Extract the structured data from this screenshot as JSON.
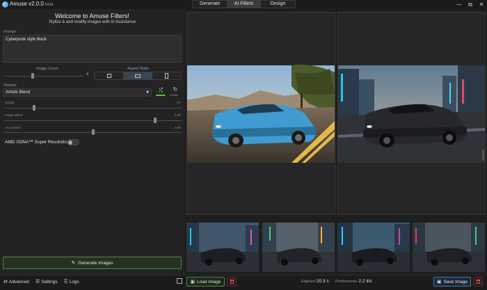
{
  "app": {
    "title": "Amuse v2.0.0",
    "version_tag": "beta"
  },
  "tabs": [
    {
      "label": "Generate",
      "active": false
    },
    {
      "label": "AI Filters",
      "active": true
    },
    {
      "label": "Design",
      "active": false
    }
  ],
  "window": {
    "minimize": "—",
    "restore": "⧉",
    "close": "✕"
  },
  "left": {
    "welcome": "Welcome to Amuse Filters!",
    "subtitle": "Stylize & and modify images with AI Assistance",
    "prompt_label": "Prompt",
    "prompt_value": "Cyberpunk style black",
    "image_count_label": "Image Count",
    "image_count_value": "4",
    "aspect_ratio_label": "Aspect Ratio",
    "aspect_ratio_selected": "landscape",
    "presets_label": "Presets",
    "preset_value": "Artistic Blend",
    "refresh_label": "Presets",
    "quality": {
      "label": "Quality",
      "value": "30",
      "level": 0.17
    },
    "image_blend": {
      "label": "Image Blend",
      "value": "0.85",
      "level": 0.85
    },
    "ai_assisted": {
      "label": "AI Assisted",
      "value": "0.50",
      "level": 0.5
    },
    "image_count_level": 0.16,
    "super_res_label": "AMD XDNA™ Super Resolution",
    "super_res_on": false,
    "generate_label": "Generate Images"
  },
  "bottom": {
    "advanced": "Advanced",
    "settings": "Settings",
    "logs": "Logs",
    "load_image": "Load Image",
    "elapsed_label": "Elapsed",
    "elapsed_value": "20.3 s",
    "performance_label": "Performance",
    "performance_value": "2.2 it/s",
    "save_image": "Save Image"
  },
  "colors": {
    "accent_green": "#5fbf4b",
    "accent_blue": "#3b7fbf",
    "delete_red": "#e05050"
  }
}
